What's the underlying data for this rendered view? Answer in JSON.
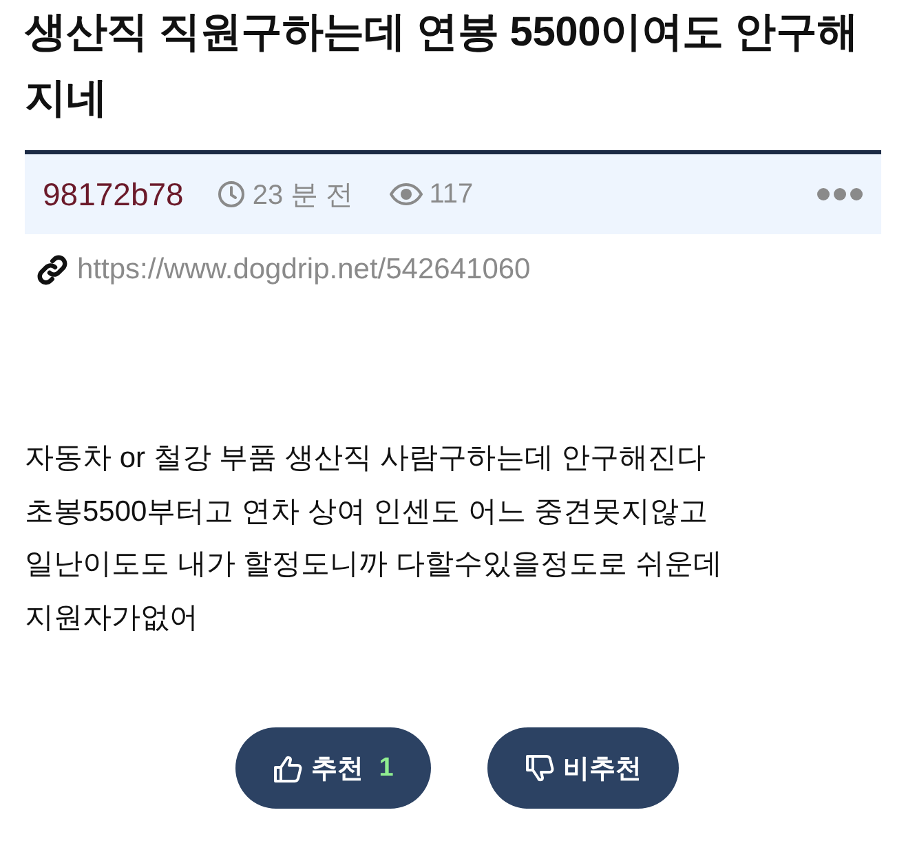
{
  "post": {
    "title": "생산직 직원구하는데 연봉 5500이여도 안구해지네",
    "author": "98172b78",
    "time": "23 분 전",
    "views": "117",
    "url": "https://www.dogdrip.net/542641060",
    "body": [
      "자동차 or 철강 부품 생산직 사람구하는데 안구해진다",
      "초봉5500부터고 연차 상여 인센도 어느 중견못지않고",
      "일난이도도 내가 할정도니까 다할수있을정도로 쉬운데",
      "지원자가없어"
    ]
  },
  "votes": [
    {
      "kind": "up",
      "label": "추천",
      "count": "1"
    },
    {
      "kind": "down",
      "label": "비추천"
    }
  ]
}
